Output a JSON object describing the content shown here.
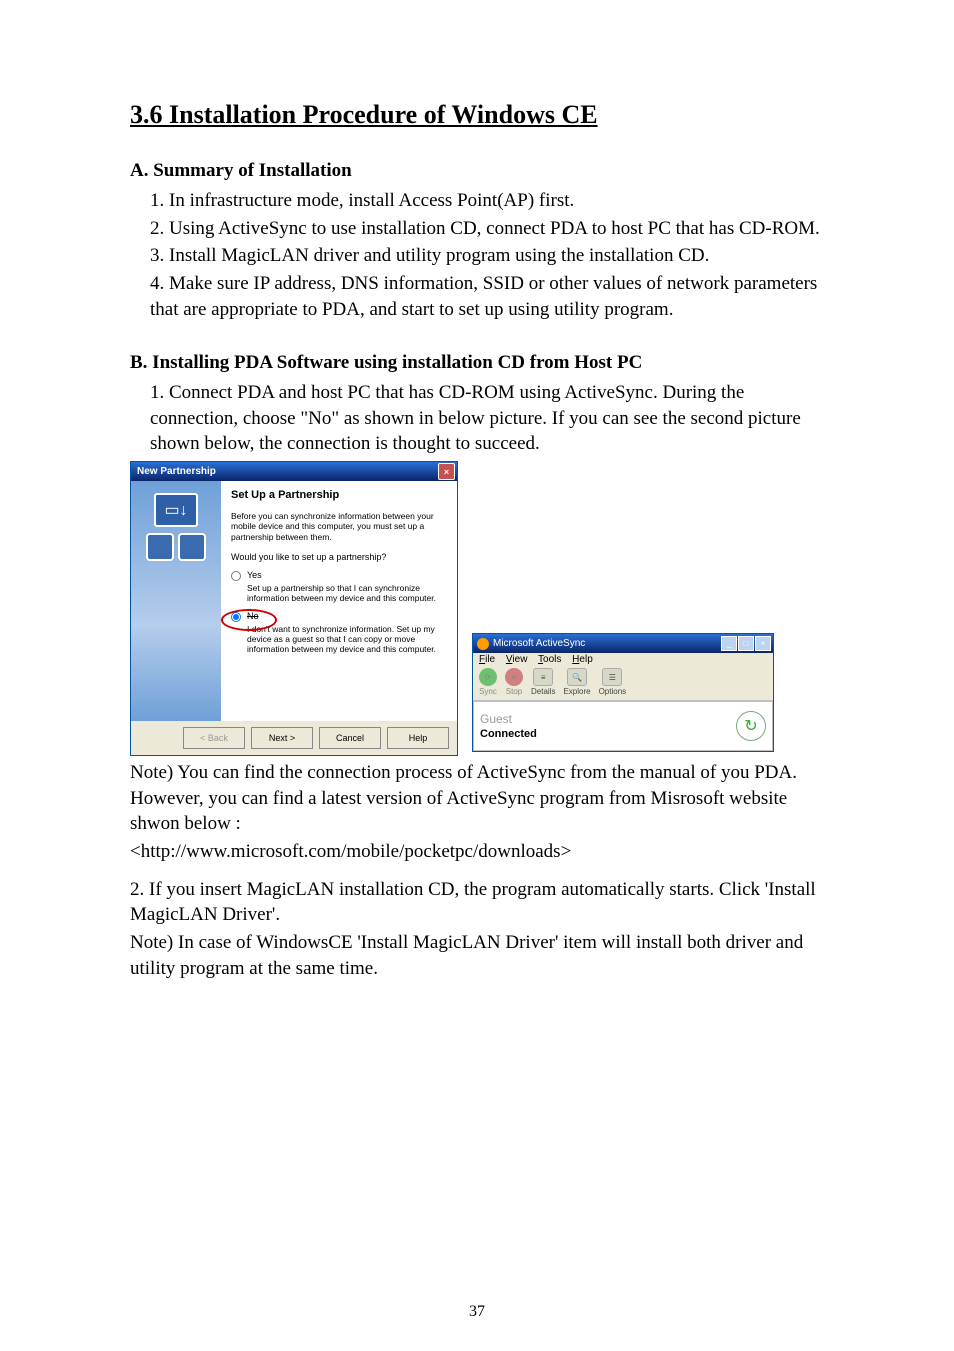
{
  "title": "3.6 Installation Procedure of Windows CE",
  "sectionA": {
    "heading": "A. Summary of Installation",
    "lines": [
      "1. In infrastructure mode, install Access Point(AP) first.",
      "2. Using ActiveSync to use installation CD, connect PDA to host PC that has CD-ROM.",
      "3. Install MagicLAN driver and utility program using the installation CD.",
      "4. Make sure IP address, DNS information, SSID or other values of network parameters that are appropriate to PDA, and start to set up using utility program."
    ]
  },
  "sectionB": {
    "heading": "B. Installing PDA Software using installation CD from Host PC",
    "step1": "1. Connect PDA and host PC that has CD-ROM using ActiveSync. During the connection, choose \"No\" as shown in below picture. If you can see the second picture shown below, the connection is thought to succeed.",
    "note1": "Note) You can find the connection process of ActiveSync from the manual of you PDA. However, you can find a latest version of ActiveSync program from Misrosoft website shwon below :",
    "url": "<http://www.microsoft.com/mobile/pocketpc/downloads>",
    "step2": "2. If you insert MagicLAN installation CD, the program automatically starts. Click 'Install MagicLAN Driver'.",
    "note2": "Note) In case of WindowsCE 'Install MagicLAN Driver' item will install both driver and utility program at the same time."
  },
  "newPartnership": {
    "title": "New Partnership",
    "heading": "Set Up a Partnership",
    "intro": "Before you can synchronize information between your mobile device and this computer, you must set up a partnership between them.",
    "question": "Would you like to set up a partnership?",
    "optYes": {
      "label": "Yes",
      "desc": "Set up a partnership so that I can synchronize information between my device and this computer."
    },
    "optNo": {
      "label": "No",
      "desc": "I don't want to synchronize information. Set up my device as a guest so that I can copy or move information between my device and this computer."
    },
    "buttons": {
      "back": "< Back",
      "next": "Next >",
      "cancel": "Cancel",
      "help": "Help"
    }
  },
  "activeSync": {
    "title": "Microsoft ActiveSync",
    "menu": {
      "file": "File",
      "view": "View",
      "tools": "Tools",
      "help": "Help"
    },
    "toolbar": {
      "sync": "Sync",
      "stop": "Stop",
      "details": "Details",
      "explore": "Explore",
      "options": "Options"
    },
    "status": {
      "guest": "Guest",
      "connected": "Connected"
    }
  },
  "pageNumber": "37"
}
